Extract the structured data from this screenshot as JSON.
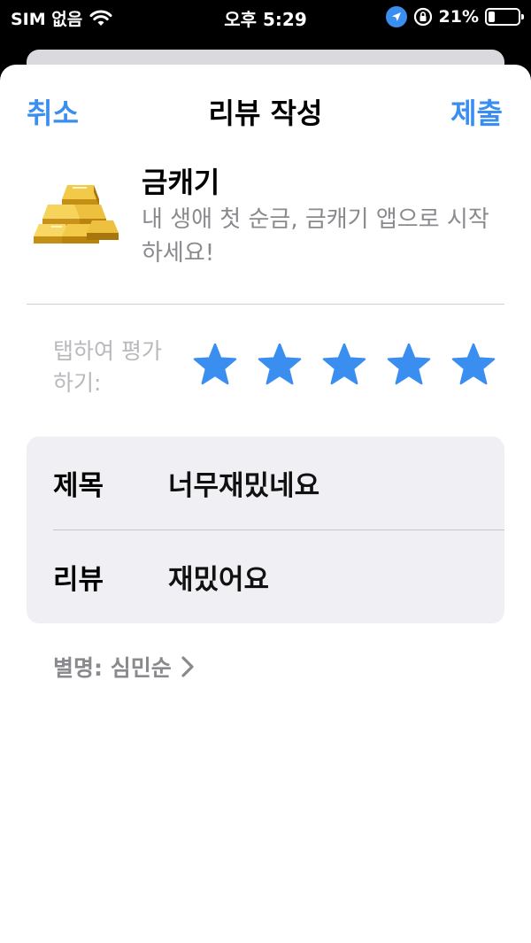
{
  "status_bar": {
    "carrier": "SIM 없음",
    "time": "오후 5:29",
    "battery_percent": "21%",
    "battery_level": 0.21
  },
  "nav": {
    "cancel": "취소",
    "title": "리뷰 작성",
    "submit": "제출"
  },
  "app": {
    "name": "금캐기",
    "subtitle": "내 생애 첫 순금, 금캐기 앱으로 시작하세요!",
    "icon": "gold-bars-icon"
  },
  "rating": {
    "label": "탭하여 평가하기:",
    "stars": 5,
    "max_stars": 5,
    "accent": "#3a8ef0"
  },
  "form": {
    "title_label": "제목",
    "title_value": "너무재밌네요",
    "review_label": "리뷰",
    "review_value": "재밌어요"
  },
  "nickname": "별명: 심민순"
}
